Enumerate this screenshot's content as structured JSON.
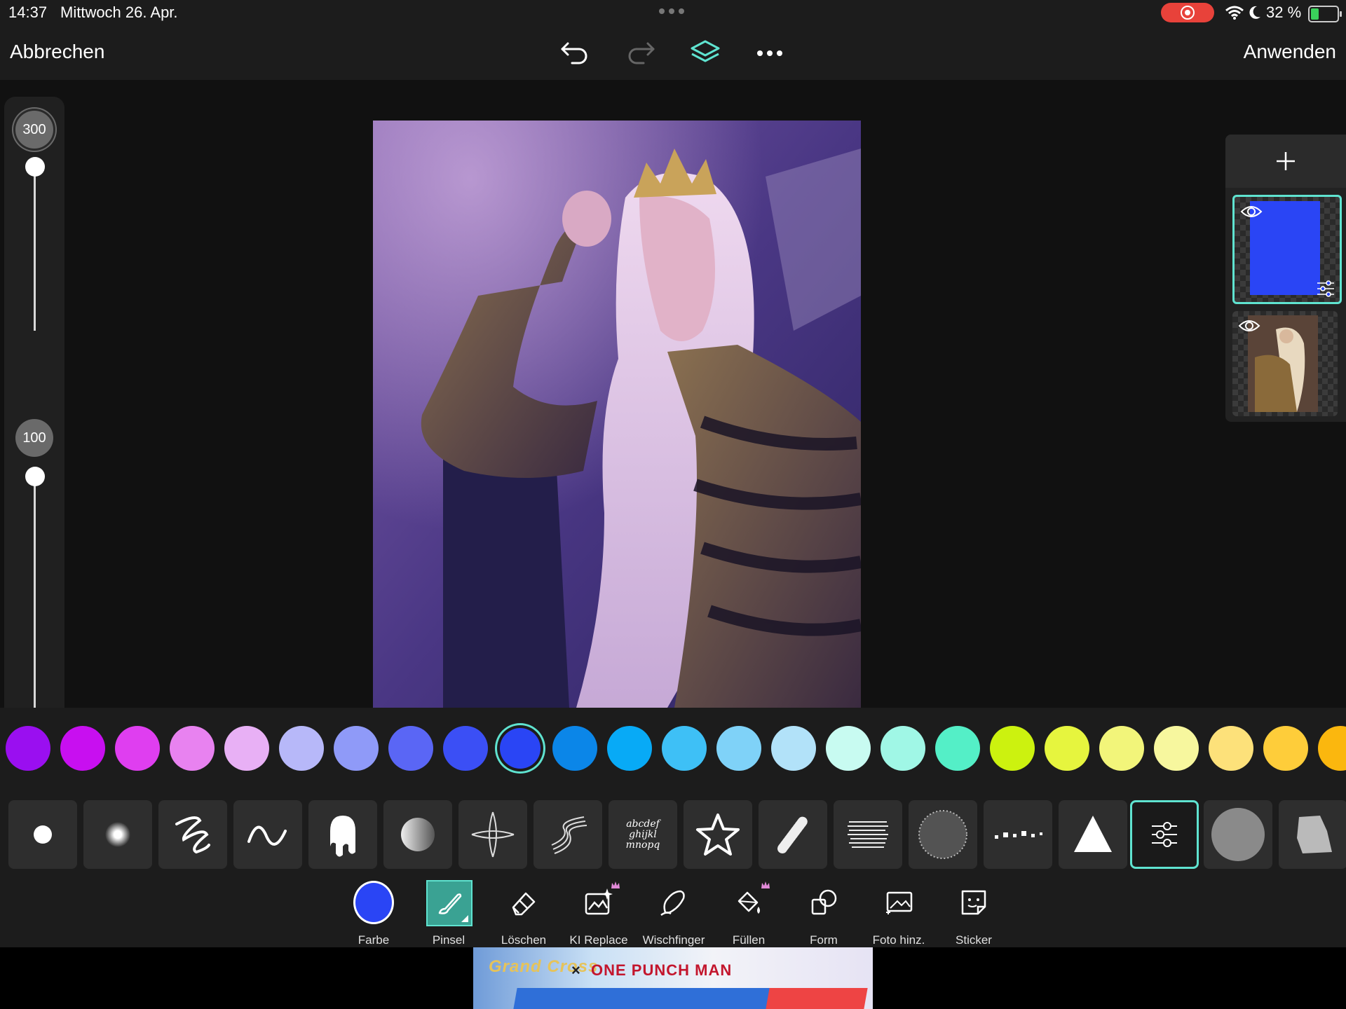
{
  "status_bar": {
    "time": "14:37",
    "date": "Mittwoch 26. Apr.",
    "battery_text": "32 %",
    "battery_level": 0.32
  },
  "toolbar": {
    "cancel_label": "Abbrechen",
    "apply_label": "Anwenden",
    "icons": [
      "undo-icon",
      "redo-icon",
      "layers-icon",
      "more-icon"
    ]
  },
  "brush_size": {
    "value": "300",
    "level": 0.0
  },
  "brush_opacity": {
    "value": "100",
    "level": 0.0
  },
  "layers_panel": {
    "add_icon": "plus-icon",
    "layers": [
      {
        "name": "paint-layer",
        "fill_color": "#2a45f5",
        "selected": true,
        "visible": true
      },
      {
        "name": "photo-layer",
        "selected": false,
        "visible": true
      }
    ]
  },
  "palette": {
    "colors": [
      "#9a0ff0",
      "#c80ff0",
      "#df3ef0",
      "#e882f0",
      "#e8b0f5",
      "#b7b8f9",
      "#8f9af8",
      "#5a66f5",
      "#3b4ff5",
      "#2a45f5",
      "#0b86e8",
      "#08aaf6",
      "#3ec0f6",
      "#7fd2f8",
      "#b2e2f9",
      "#c8fbf1",
      "#a0f7e6",
      "#54efc7",
      "#ccf20f",
      "#e6f53e",
      "#f2f57a",
      "#f7f79e",
      "#fde17a",
      "#fecd3a",
      "#fbb70e"
    ],
    "selected_index": 9
  },
  "brushes": {
    "items": [
      "round-hard-brush",
      "round-soft-brush",
      "neon-scribble-brush",
      "wave-line-brush",
      "drip-brush",
      "gradient-circle-brush",
      "cross-sparkle-brush",
      "multi-line-brush",
      "text-brush",
      "star-brush",
      "chalk-brush",
      "dry-bristle-brush",
      "noise-circle-brush",
      "dotted-line-brush",
      "spray-triangle-brush",
      "brush-settings",
      "grain-circle-brush",
      "rough-texture-brush"
    ],
    "text_brush_lines": [
      "abcdef",
      "ghijkl",
      "mnopq"
    ],
    "selected_index": 15
  },
  "tools": [
    {
      "id": "color",
      "label": "Farbe",
      "icon": "color-swatch-icon",
      "color": "#2a45f5"
    },
    {
      "id": "brush",
      "label": "Pinsel",
      "icon": "brush-icon",
      "active": true
    },
    {
      "id": "erase",
      "label": "Löschen",
      "icon": "eraser-icon"
    },
    {
      "id": "ai-replace",
      "label": "KI Replace",
      "icon": "ai-replace-icon",
      "premium": true
    },
    {
      "id": "smudge",
      "label": "Wischfinger",
      "icon": "smudge-icon"
    },
    {
      "id": "fill",
      "label": "Füllen",
      "icon": "bucket-icon",
      "premium": true
    },
    {
      "id": "shape",
      "label": "Form",
      "icon": "shape-icon"
    },
    {
      "id": "add-photo",
      "label": "Foto hinz.",
      "icon": "add-photo-icon"
    },
    {
      "id": "sticker",
      "label": "Sticker",
      "icon": "sticker-icon"
    }
  ],
  "ad": {
    "brand": "Grand Cross",
    "collab": "ONE PUNCH MAN"
  },
  "accent_color": "#5fe3d0"
}
